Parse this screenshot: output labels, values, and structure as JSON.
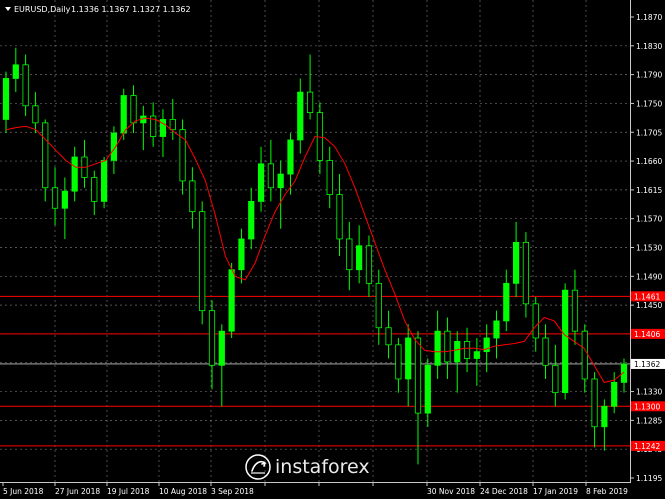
{
  "header": {
    "symbol_label": "EURUSD,Daily",
    "ohlc_label": "1.1336 1.1367 1.1327 1.1362"
  },
  "watermark": {
    "text": "instaforex"
  },
  "colors": {
    "background": "#000000",
    "candle_up": "#00ff00",
    "candle_down": "#000000",
    "grid": "#6e6e6e",
    "moving_average": "#ff0000",
    "support_resistance": "#ff0000",
    "current_price": "#c0c0c0"
  },
  "chart_data": {
    "type": "candlestick",
    "symbol": "EURUSD",
    "timeframe": "Daily",
    "ylim": [
      1.1195,
      1.1825
    ],
    "y_ticks": [
      "1.1870",
      "1.1830",
      "1.1790",
      "1.1750",
      "1.1705",
      "1.1660",
      "1.1615",
      "1.1570",
      "1.1530",
      "1.1490",
      "1.1450",
      "1.1410",
      "1.1370",
      "1.1330",
      "1.1285",
      "1.1245",
      "1.1195"
    ],
    "x_ticks": [
      "5 Jun 2018",
      "27 Jun 2018",
      "19 Jul 2018",
      "10 Aug 2018",
      "3 Sep 2018",
      "",
      "",
      "",
      "30 Nov 2018",
      "24 Dec 2018",
      "17 Jan 2019",
      "8 Feb 2019"
    ],
    "grid": true,
    "current_price": 1.1362,
    "current_price_label": "1.1362",
    "levels": [
      {
        "value": 1.1461,
        "label": "1.1461"
      },
      {
        "value": 1.1406,
        "label": "1.1406"
      },
      {
        "value": 1.13,
        "label": "1.1300"
      },
      {
        "value": 1.1242,
        "label": "1.1242"
      }
    ],
    "moving_average": {
      "color": "#ff0000",
      "values": [
        1.1705,
        1.1708,
        1.171,
        1.1705,
        1.169,
        1.1675,
        1.166,
        1.165,
        1.165,
        1.1655,
        1.166,
        1.168,
        1.1705,
        1.1718,
        1.1722,
        1.172,
        1.1712,
        1.17,
        1.169,
        1.1662,
        1.163,
        1.158,
        1.152,
        1.149,
        1.1485,
        1.151,
        1.155,
        1.1585,
        1.161,
        1.163,
        1.1665,
        1.1695,
        1.1693,
        1.168,
        1.1655,
        1.162,
        1.158,
        1.154,
        1.15,
        1.1465,
        1.1425,
        1.1398,
        1.1382,
        1.138,
        1.138,
        1.1382,
        1.1385,
        1.1385,
        1.1383,
        1.1388,
        1.139,
        1.1392,
        1.1395,
        1.1415,
        1.143,
        1.1425,
        1.1405,
        1.1395,
        1.1385,
        1.136,
        1.1335,
        1.1338,
        1.135
      ]
    },
    "candles": [
      [
        1.172,
        1.179,
        1.17,
        1.178
      ],
      [
        1.178,
        1.1825,
        1.176,
        1.18
      ],
      [
        1.18,
        1.1815,
        1.1725,
        1.174
      ],
      [
        1.174,
        1.176,
        1.17,
        1.1715
      ],
      [
        1.1715,
        1.172,
        1.16,
        1.162
      ],
      [
        1.162,
        1.165,
        1.1565,
        1.159
      ],
      [
        1.159,
        1.1635,
        1.1545,
        1.1615
      ],
      [
        1.1615,
        1.168,
        1.16,
        1.1665
      ],
      [
        1.1665,
        1.169,
        1.162,
        1.1635
      ],
      [
        1.1635,
        1.1645,
        1.158,
        1.16
      ],
      [
        1.16,
        1.1665,
        1.159,
        1.166
      ],
      [
        1.166,
        1.171,
        1.164,
        1.17
      ],
      [
        1.17,
        1.1765,
        1.169,
        1.1755
      ],
      [
        1.1755,
        1.177,
        1.17,
        1.1715
      ],
      [
        1.1715,
        1.174,
        1.1675,
        1.1725
      ],
      [
        1.1725,
        1.1745,
        1.168,
        1.1695
      ],
      [
        1.1695,
        1.1735,
        1.1665,
        1.172
      ],
      [
        1.172,
        1.175,
        1.169,
        1.1705
      ],
      [
        1.1705,
        1.172,
        1.161,
        1.163
      ],
      [
        1.163,
        1.165,
        1.156,
        1.1585
      ],
      [
        1.1585,
        1.16,
        1.142,
        1.144
      ],
      [
        1.144,
        1.1455,
        1.1325,
        1.136
      ],
      [
        1.136,
        1.142,
        1.13,
        1.141
      ],
      [
        1.141,
        1.151,
        1.14,
        1.15
      ],
      [
        1.15,
        1.156,
        1.148,
        1.1545
      ],
      [
        1.1545,
        1.162,
        1.153,
        1.16
      ],
      [
        1.16,
        1.168,
        1.1585,
        1.1655
      ],
      [
        1.1655,
        1.169,
        1.16,
        1.162
      ],
      [
        1.162,
        1.166,
        1.156,
        1.164
      ],
      [
        1.164,
        1.17,
        1.161,
        1.169
      ],
      [
        1.169,
        1.178,
        1.167,
        1.176
      ],
      [
        1.176,
        1.1815,
        1.172,
        1.173
      ],
      [
        1.173,
        1.1745,
        1.164,
        1.166
      ],
      [
        1.166,
        1.168,
        1.159,
        1.161
      ],
      [
        1.161,
        1.164,
        1.152,
        1.1545
      ],
      [
        1.1545,
        1.157,
        1.147,
        1.15
      ],
      [
        1.15,
        1.1565,
        1.148,
        1.1535
      ],
      [
        1.1535,
        1.155,
        1.146,
        1.148
      ],
      [
        1.148,
        1.15,
        1.139,
        1.1415
      ],
      [
        1.1415,
        1.144,
        1.137,
        1.139
      ],
      [
        1.139,
        1.14,
        1.132,
        1.134
      ],
      [
        1.134,
        1.142,
        1.13,
        1.14
      ],
      [
        1.14,
        1.141,
        1.1215,
        1.129
      ],
      [
        1.129,
        1.137,
        1.127,
        1.136
      ],
      [
        1.136,
        1.144,
        1.134,
        1.141
      ],
      [
        1.141,
        1.143,
        1.134,
        1.1365
      ],
      [
        1.1365,
        1.141,
        1.132,
        1.1395
      ],
      [
        1.1395,
        1.1415,
        1.135,
        1.137
      ],
      [
        1.137,
        1.14,
        1.133,
        1.138
      ],
      [
        1.138,
        1.142,
        1.135,
        1.14
      ],
      [
        1.14,
        1.144,
        1.137,
        1.1425
      ],
      [
        1.1425,
        1.15,
        1.141,
        1.148
      ],
      [
        1.148,
        1.157,
        1.146,
        1.154
      ],
      [
        1.154,
        1.1555,
        1.143,
        1.145
      ],
      [
        1.145,
        1.146,
        1.138,
        1.14
      ],
      [
        1.14,
        1.142,
        1.134,
        1.136
      ],
      [
        1.136,
        1.139,
        1.13,
        1.132
      ],
      [
        1.132,
        1.148,
        1.131,
        1.147
      ],
      [
        1.147,
        1.15,
        1.139,
        1.141
      ],
      [
        1.141,
        1.142,
        1.132,
        1.134
      ],
      [
        1.134,
        1.135,
        1.124,
        1.127
      ],
      [
        1.127,
        1.131,
        1.1235,
        1.13
      ],
      [
        1.13,
        1.135,
        1.129,
        1.1335
      ],
      [
        1.1335,
        1.137,
        1.132,
        1.1362
      ]
    ]
  }
}
